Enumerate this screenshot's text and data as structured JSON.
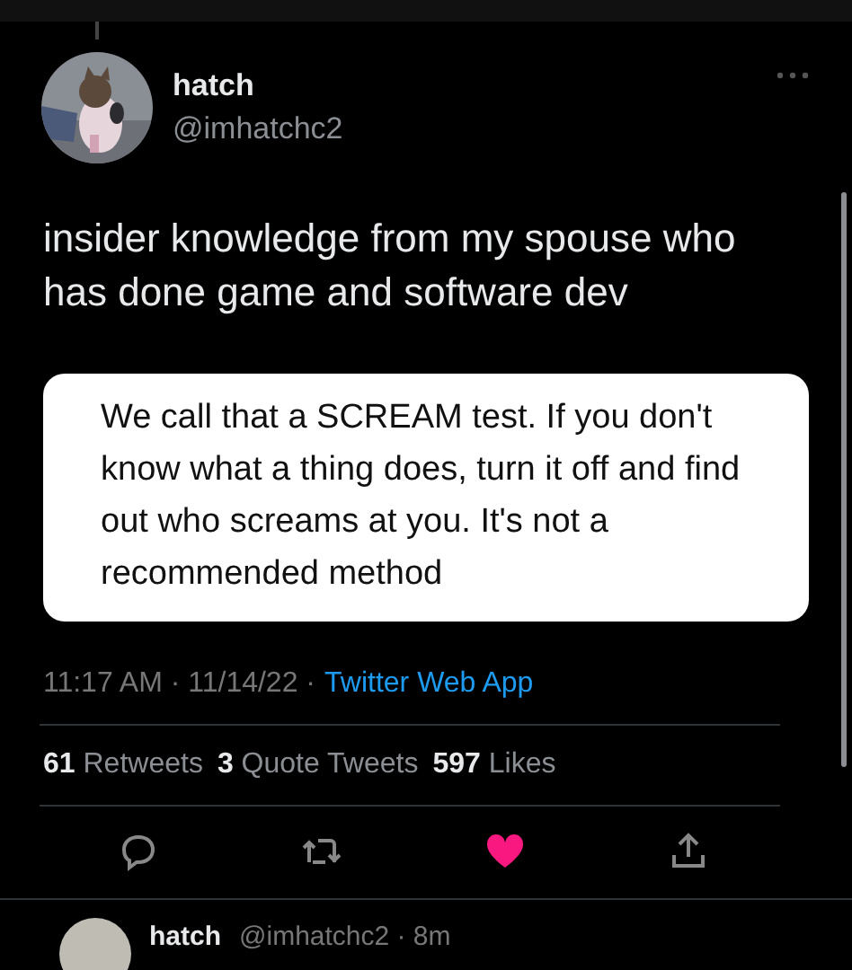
{
  "author": {
    "name": "hatch",
    "handle": "@imhatchc2"
  },
  "tweet": {
    "text": "insider knowledge from my spouse who has done game and software dev",
    "quote": "We call that a SCREAM test. If you don't know what a thing does, turn it off and find out who screams at you. It's not a recommended method"
  },
  "meta": {
    "timestamp": "11:17 AM · 11/14/22 ·",
    "source": "Twitter Web App"
  },
  "stats": [
    {
      "count": "61",
      "label": "Retweets"
    },
    {
      "count": "3",
      "label": "Quote Tweets"
    },
    {
      "count": "597",
      "label": "Likes"
    }
  ],
  "actions": {
    "liked": true
  },
  "reply": {
    "name": "hatch",
    "handle": "@imhatchc2 · 8m"
  }
}
